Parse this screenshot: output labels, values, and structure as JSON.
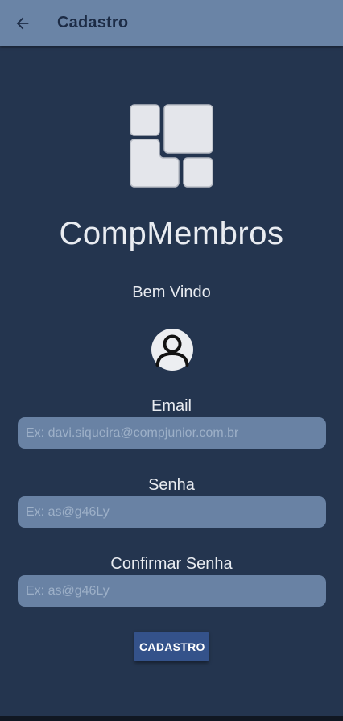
{
  "appbar": {
    "title": "Cadastro",
    "back_icon": "arrow-left-icon"
  },
  "hero": {
    "logo_icon": "tiles-logo-icon",
    "app_name": "CompMembros",
    "welcome": "Bem Vindo",
    "avatar_icon": "user-avatar-icon"
  },
  "form": {
    "email": {
      "label": "Email",
      "placeholder": "Ex: davi.siqueira@compjunior.com.br",
      "value": ""
    },
    "password": {
      "label": "Senha",
      "placeholder": "Ex: as@g46Ly",
      "value": ""
    },
    "confirm_password": {
      "label": "Confirmar Senha",
      "placeholder": "Ex: as@g46Ly",
      "value": ""
    },
    "submit_label": "CADASTRO"
  },
  "colors": {
    "appbar_bg": "#6a84a6",
    "screen_bg": "#24354f",
    "input_bg": "#6982a4",
    "button_bg": "#34528a",
    "text": "#e9ecf1"
  }
}
